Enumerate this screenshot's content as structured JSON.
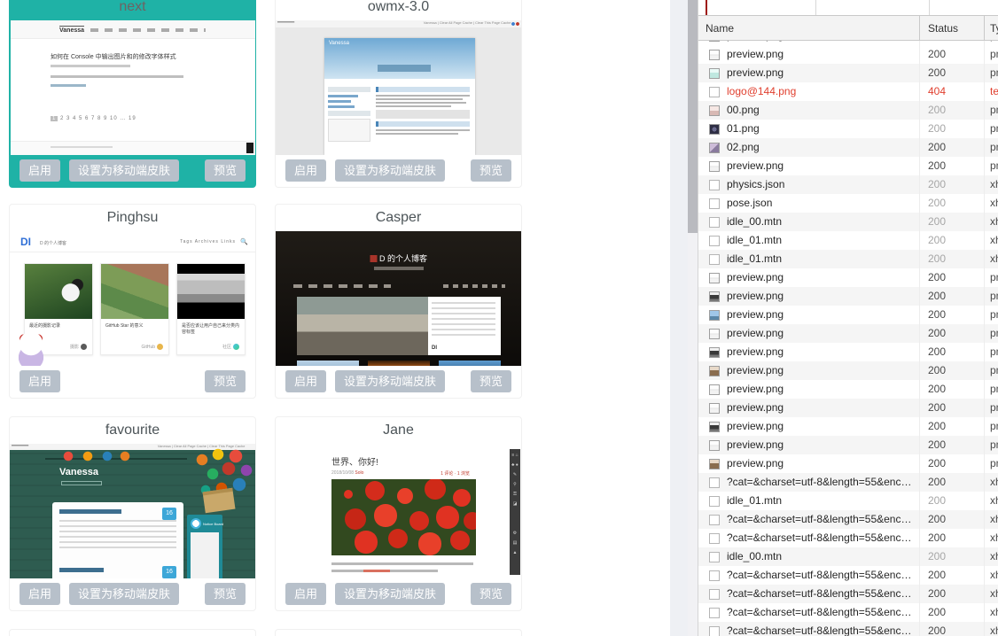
{
  "theme_page": {
    "buttons": {
      "enable": "启用",
      "set_mobile": "设置为移动端皮肤",
      "preview": "预览"
    },
    "cards": [
      {
        "title": "next",
        "active": true,
        "preview": {
          "blog_title": "Vanessa",
          "post_title": "如何在 Console 中输出图片和的修改字体样式",
          "pagination_current": "1",
          "pagination_rest": "2 3 4 5 6 7 8 9 10 … 19"
        }
      },
      {
        "title": "owmx-3.0",
        "preview": {
          "blog_title": "Vanessa",
          "admin_bar": "Vanessa | Clear All Page Cache | Clear This Page Cache"
        }
      },
      {
        "title": "Pinghsu",
        "preview": {
          "logo": "DI",
          "blog_title": "D 的个人博客",
          "nav": "Tags   Archives   Links",
          "search_icon": "🔍",
          "posts": [
            {
              "caption": "最近的摄影记录",
              "tag": "摄影"
            },
            {
              "caption": "GitHub Star 的意义",
              "tag": "GitHub"
            },
            {
              "caption": "是否应该让用户自己来分类内容标签",
              "tag": "社区"
            }
          ]
        }
      },
      {
        "title": "Casper",
        "preview": {
          "blog_title": "D 的个人博客",
          "footer_logo": "DI"
        }
      },
      {
        "title": "favourite",
        "preview": {
          "blog_title": "Vanessa",
          "admin_bar": "Vanessa | Clear All Page Cache | Clear This Page Cache",
          "notice_board": "Notice Board",
          "date_badge_1": "16",
          "date_badge_2": "16"
        }
      },
      {
        "title": "Jane",
        "preview": {
          "post_title": "世界、你好!",
          "date": "2018/10/08",
          "category": "Solo",
          "meta_right": "1 评论 · 1 浏览",
          "toolbar_icons_top": "≡ ⌂ ♣ ● ✎ ⚲ ⚿ ◪",
          "toolbar_icons_bottom": "⚙ ▤ ▲"
        }
      }
    ]
  },
  "devtools": {
    "columns": {
      "name": "Name",
      "status": "Status",
      "type": "Type"
    },
    "rows": [
      {
        "name": "preview.png",
        "status": "200",
        "type": "png",
        "icon": "image-icon",
        "thumb": "t1"
      },
      {
        "name": "preview.png",
        "status": "200",
        "type": "png",
        "icon": "image-icon",
        "thumb": "t1"
      },
      {
        "name": "preview.png",
        "status": "200",
        "type": "png",
        "icon": "image-icon",
        "thumb": "t2"
      },
      {
        "name": "logo@144.png",
        "status": "404",
        "type": "text",
        "icon": "document-icon",
        "error": true
      },
      {
        "name": "00.png",
        "status": "200",
        "type": "png",
        "icon": "image-icon",
        "thumb": "t7",
        "dim": true
      },
      {
        "name": "01.png",
        "status": "200",
        "type": "png",
        "icon": "image-icon",
        "thumb": "t8",
        "dim": true
      },
      {
        "name": "02.png",
        "status": "200",
        "type": "png",
        "icon": "image-icon",
        "thumb": "t9"
      },
      {
        "name": "preview.png",
        "status": "200",
        "type": "png",
        "icon": "image-icon",
        "thumb": "t1"
      },
      {
        "name": "physics.json",
        "status": "200",
        "type": "xhr",
        "icon": "document-icon",
        "dim": true
      },
      {
        "name": "pose.json",
        "status": "200",
        "type": "xhr",
        "icon": "document-icon",
        "dim": true
      },
      {
        "name": "idle_00.mtn",
        "status": "200",
        "type": "xhr",
        "icon": "document-icon",
        "dim": true
      },
      {
        "name": "idle_01.mtn",
        "status": "200",
        "type": "xhr",
        "icon": "document-icon",
        "dim": true
      },
      {
        "name": "idle_01.mtn",
        "status": "200",
        "type": "xhr",
        "icon": "document-icon",
        "dim": true
      },
      {
        "name": "preview.png",
        "status": "200",
        "type": "png",
        "icon": "image-icon",
        "thumb": "t1"
      },
      {
        "name": "preview.png",
        "status": "200",
        "type": "png",
        "icon": "image-icon",
        "thumb": "t3"
      },
      {
        "name": "preview.png",
        "status": "200",
        "type": "png",
        "icon": "image-icon",
        "thumb": "t4"
      },
      {
        "name": "preview.png",
        "status": "200",
        "type": "png",
        "icon": "image-icon",
        "thumb": "t1"
      },
      {
        "name": "preview.png",
        "status": "200",
        "type": "png",
        "icon": "image-icon",
        "thumb": "t3"
      },
      {
        "name": "preview.png",
        "status": "200",
        "type": "png",
        "icon": "image-icon",
        "thumb": "t5"
      },
      {
        "name": "preview.png",
        "status": "200",
        "type": "png",
        "icon": "image-icon",
        "thumb": "t1"
      },
      {
        "name": "preview.png",
        "status": "200",
        "type": "png",
        "icon": "image-icon",
        "thumb": "t1"
      },
      {
        "name": "preview.png",
        "status": "200",
        "type": "png",
        "icon": "image-icon",
        "thumb": "t3"
      },
      {
        "name": "preview.png",
        "status": "200",
        "type": "png",
        "icon": "image-icon",
        "thumb": "t1"
      },
      {
        "name": "preview.png",
        "status": "200",
        "type": "png",
        "icon": "image-icon",
        "thumb": "t5"
      },
      {
        "name": "?cat=&charset=utf-8&length=55&enc…",
        "status": "200",
        "type": "xhr",
        "icon": "document-icon"
      },
      {
        "name": "idle_01.mtn",
        "status": "200",
        "type": "xhr",
        "icon": "document-icon",
        "dim": true
      },
      {
        "name": "?cat=&charset=utf-8&length=55&enc…",
        "status": "200",
        "type": "xhr",
        "icon": "document-icon"
      },
      {
        "name": "?cat=&charset=utf-8&length=55&enc…",
        "status": "200",
        "type": "xhr",
        "icon": "document-icon"
      },
      {
        "name": "idle_00.mtn",
        "status": "200",
        "type": "xhr",
        "icon": "document-icon",
        "dim": true
      },
      {
        "name": "?cat=&charset=utf-8&length=55&enc…",
        "status": "200",
        "type": "xhr",
        "icon": "document-icon"
      },
      {
        "name": "?cat=&charset=utf-8&length=55&enc…",
        "status": "200",
        "type": "xhr",
        "icon": "document-icon"
      },
      {
        "name": "?cat=&charset=utf-8&length=55&enc…",
        "status": "200",
        "type": "xhr",
        "icon": "document-icon"
      },
      {
        "name": "?cat=&charset=utf-8&length=55&enc…",
        "status": "200",
        "type": "xhr",
        "icon": "document-icon"
      }
    ]
  }
}
